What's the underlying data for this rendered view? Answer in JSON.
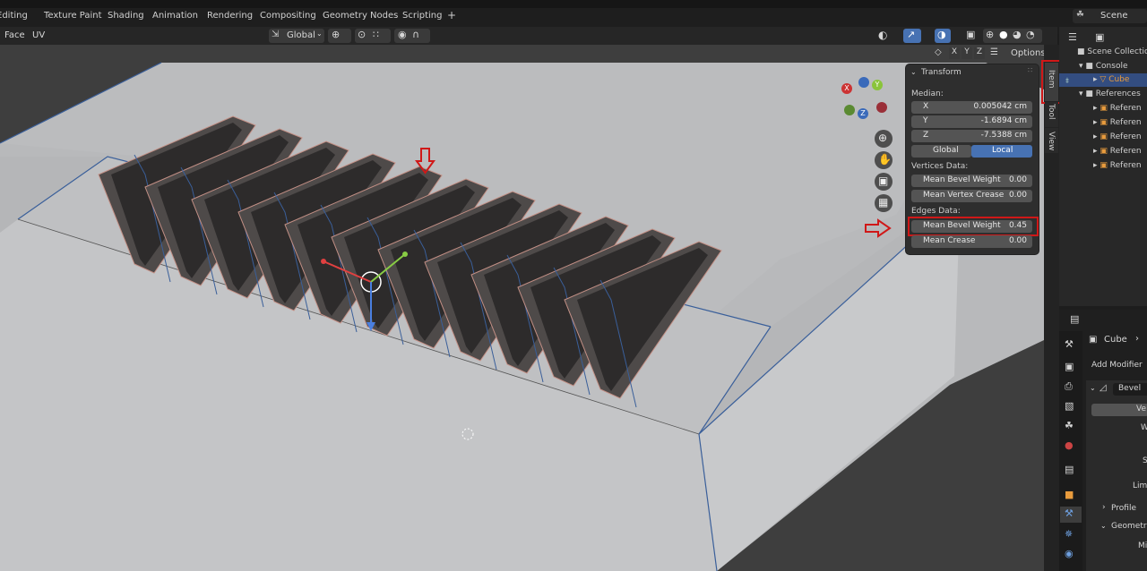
{
  "topbar": {
    "tabs": [
      "Editing",
      "Texture Paint",
      "Shading",
      "Animation",
      "Rendering",
      "Compositing",
      "Geometry Nodes",
      "Scripting",
      "+"
    ],
    "scene_label": "Scene"
  },
  "viewport_header": {
    "menus": [
      "Face",
      "UV"
    ],
    "orientation": "Global",
    "axes": [
      "X",
      "Y",
      "Z"
    ],
    "options_label": "Options"
  },
  "npanel": {
    "section": "Transform",
    "median_label": "Median:",
    "median": [
      {
        "axis": "X",
        "value": "0.005042 cm"
      },
      {
        "axis": "Y",
        "value": "-1.6894 cm"
      },
      {
        "axis": "Z",
        "value": "-7.5388 cm"
      }
    ],
    "space_global": "Global",
    "space_local": "Local",
    "vertices_label": "Vertices Data:",
    "vertices": [
      {
        "name": "Mean Bevel Weight",
        "value": "0.00"
      },
      {
        "name": "Mean Vertex Crease",
        "value": "0.00"
      }
    ],
    "edges_label": "Edges Data:",
    "edges": [
      {
        "name": "Mean Bevel Weight",
        "value": "0.45"
      },
      {
        "name": "Mean Crease",
        "value": "0.00"
      }
    ],
    "tabs": [
      "Item",
      "Tool",
      "View"
    ]
  },
  "navigation_gizmo": {
    "x": "X",
    "y": "Y",
    "z": "Z"
  },
  "outliner": {
    "rows": [
      "Scene Collection",
      "Console",
      "Cube",
      "References",
      "Referen",
      "Referen",
      "Referen",
      "Referen",
      "Referen"
    ]
  },
  "properties": {
    "object_name": "Cube",
    "add_modifier": "Add Modifier",
    "modifier_name": "Bevel",
    "fields": [
      "Ve",
      "W",
      "S",
      "Lim"
    ],
    "sections": [
      "Profile",
      "Geometry",
      "Mi"
    ]
  },
  "colors": {
    "accent_blue": "#4772b3",
    "active_orange": "#e89b3d",
    "annotation_red": "#d01818"
  }
}
